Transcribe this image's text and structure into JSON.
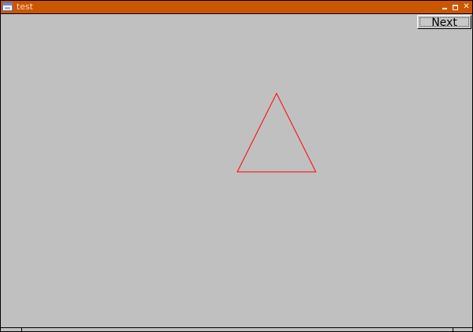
{
  "window": {
    "title": "test",
    "accent_color": "#cc5500",
    "background_color": "#c0c0c0",
    "controls": {
      "minimize_icon": "minimize-icon",
      "maximize_icon": "maximize-icon",
      "close_icon": "close-icon",
      "close_glyph": "✕"
    }
  },
  "toolbar": {
    "next_label": "Next"
  },
  "drawing": {
    "shape": "triangle",
    "stroke_color": "#ff0000"
  }
}
